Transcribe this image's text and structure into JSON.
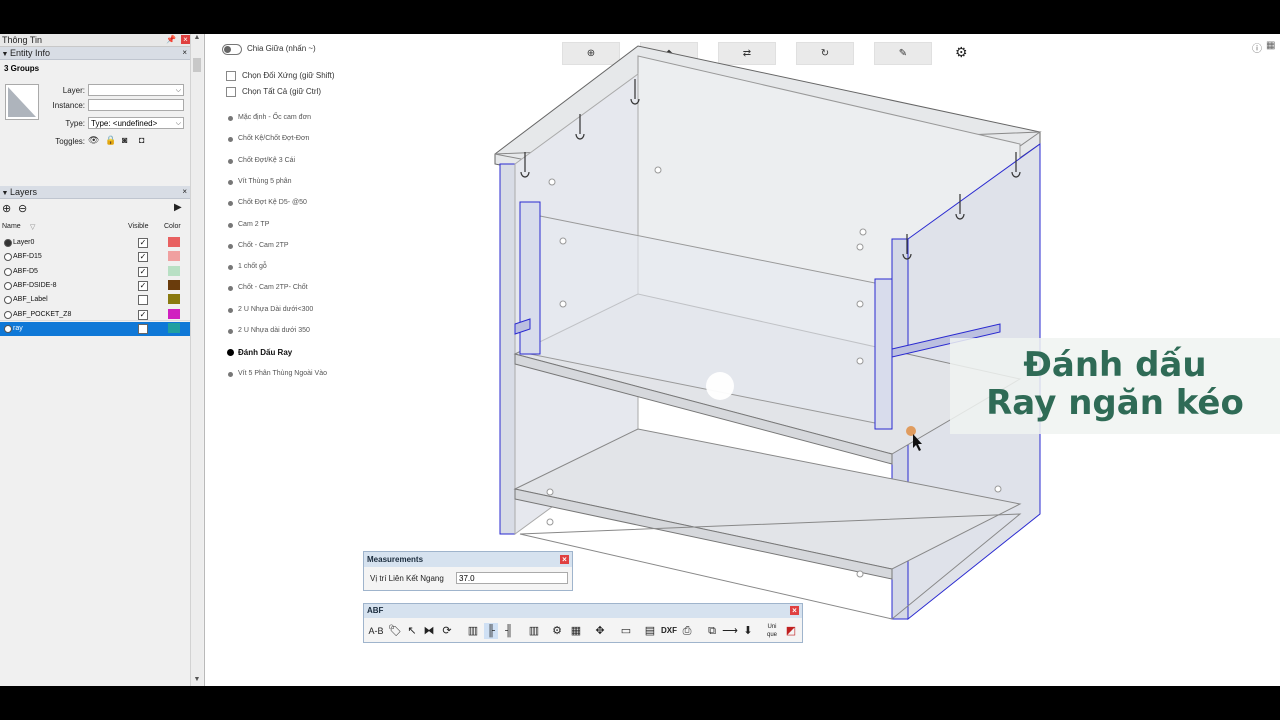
{
  "tray": {
    "title": "Thông Tin",
    "entity_info": {
      "header": "Entity Info",
      "summary": "3 Groups",
      "layer_label": "Layer:",
      "layer_value": "",
      "instance_label": "Instance:",
      "instance_value": "",
      "type_label": "Type:",
      "type_value": "Type: <undefined>",
      "toggles_label": "Toggles:"
    },
    "layers": {
      "header": "Layers",
      "col_name": "Name",
      "col_visible": "Visible",
      "col_color": "Color",
      "rows": [
        {
          "name": "Layer0",
          "active": true,
          "visible": true,
          "color": "#e86060"
        },
        {
          "name": "ABF-D15",
          "active": false,
          "visible": true,
          "color": "#f0a0a0"
        },
        {
          "name": "ABF-D5",
          "active": false,
          "visible": true,
          "color": "#b8e0c4"
        },
        {
          "name": "ABF-DSIDE-8",
          "active": false,
          "visible": true,
          "color": "#6a3c0c"
        },
        {
          "name": "ABF_Label",
          "active": false,
          "visible": false,
          "color": "#8a7a10"
        },
        {
          "name": "ABF_POCKET_Z8",
          "active": false,
          "visible": true,
          "color": "#d020c0"
        },
        {
          "name": "ray",
          "active": false,
          "visible": true,
          "color": "#20a0a0",
          "selected": true
        }
      ]
    }
  },
  "menu": {
    "toggle_label": "Chia Giữa (nhấn ~)",
    "checkbox_items": [
      "Chọn Đối Xứng (giữ Shift)",
      "Chọn Tất Cả (giữ Ctrl)"
    ],
    "items": [
      "Mặc định - Ốc cam đơn",
      "Chốt Kệ/Chốt Đợt-Đơn",
      "Chốt Đợt/Kệ 3 Cái",
      "Vít Thùng 5 phân",
      "Chốt Đợt Kệ D5- @50",
      "Cam 2 TP",
      "Chốt - Cam 2TP",
      "1 chốt gỗ",
      "Chốt - Cam 2TP- Chốt",
      "2 U Nhựa Dài dưới<300",
      "2 U Nhựa dài dưới 350",
      "Đánh Dấu Ray",
      "Vít 5 Phân Thùng Ngoài Vào"
    ],
    "selected_index": 11
  },
  "caption": {
    "line1": "Đánh dấu",
    "line2": "Ray ngăn kéo"
  },
  "measurements": {
    "title": "Measurements",
    "label": "Vị trí Liên Kết Ngang",
    "value": "37.0"
  },
  "abf_toolbar": {
    "title": "ABF",
    "ab_label": "A-B",
    "dxf_label": "DXF",
    "uni_label": "Uni",
    "que_label": "que"
  },
  "colors": {
    "accent_blue": "#0f78d7",
    "caption_green": "#2f6b56",
    "highlight_edge": "#2a2ad0"
  }
}
